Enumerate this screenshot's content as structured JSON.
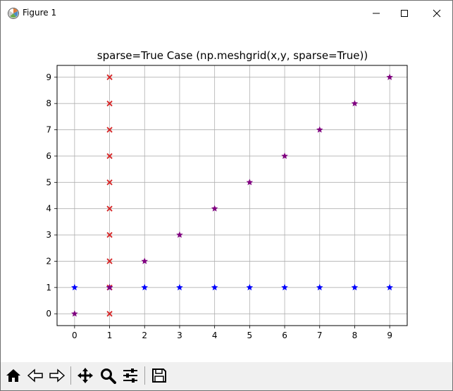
{
  "window": {
    "title": "Figure 1"
  },
  "icons": {
    "app": "matplotlib-figure-icon",
    "minimize": "minimize-icon",
    "maximize": "maximize-icon",
    "close": "close-icon"
  },
  "toolbar": {
    "buttons": [
      {
        "name": "home-button",
        "icon": "home-icon"
      },
      {
        "name": "back-button",
        "icon": "back-arrow-icon"
      },
      {
        "name": "forward-button",
        "icon": "forward-arrow-icon"
      },
      {
        "name": "pan-button",
        "icon": "move-icon"
      },
      {
        "name": "zoom-button",
        "icon": "magnifier-icon"
      },
      {
        "name": "configure-subplots-button",
        "icon": "sliders-icon"
      },
      {
        "name": "save-button",
        "icon": "save-icon"
      }
    ]
  },
  "colors": {
    "x_marker": "#d62728",
    "star_blue": "#0000ff",
    "star_purple": "#800080",
    "grid": "#b0b0b0"
  },
  "chart_data": {
    "type": "scatter",
    "title": "sparse=True Case (np.meshgrid(x,y, sparse=True))",
    "xlabel": "",
    "ylabel": "",
    "xlim": [
      -0.5,
      9.5
    ],
    "ylim": [
      -0.45,
      9.45
    ],
    "xticks": [
      0,
      1,
      2,
      3,
      4,
      5,
      6,
      7,
      8,
      9
    ],
    "yticks": [
      0,
      1,
      2,
      3,
      4,
      5,
      6,
      7,
      8,
      9
    ],
    "grid": true,
    "series": [
      {
        "marker": "x",
        "color": "#d62728",
        "points": [
          [
            1,
            0
          ],
          [
            1,
            1
          ],
          [
            1,
            2
          ],
          [
            1,
            3
          ],
          [
            1,
            4
          ],
          [
            1,
            5
          ],
          [
            1,
            6
          ],
          [
            1,
            7
          ],
          [
            1,
            8
          ],
          [
            1,
            9
          ]
        ]
      },
      {
        "marker": "*",
        "color": "#0000ff",
        "points": [
          [
            0,
            1
          ],
          [
            1,
            1
          ],
          [
            2,
            1
          ],
          [
            3,
            1
          ],
          [
            4,
            1
          ],
          [
            5,
            1
          ],
          [
            6,
            1
          ],
          [
            7,
            1
          ],
          [
            8,
            1
          ],
          [
            9,
            1
          ]
        ]
      },
      {
        "marker": "*",
        "color": "#800080",
        "points": [
          [
            0,
            0
          ],
          [
            1,
            1
          ],
          [
            2,
            2
          ],
          [
            3,
            3
          ],
          [
            4,
            4
          ],
          [
            5,
            5
          ],
          [
            6,
            6
          ],
          [
            7,
            7
          ],
          [
            8,
            8
          ],
          [
            9,
            9
          ]
        ]
      }
    ]
  }
}
